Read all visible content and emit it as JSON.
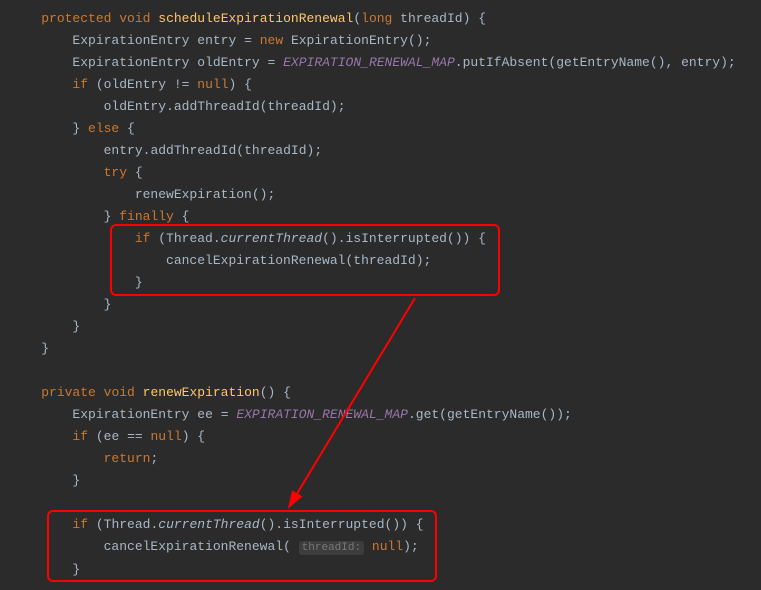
{
  "code": {
    "line1": {
      "kw1": "protected",
      "kw2": "void",
      "method": "scheduleExpirationRenewal",
      "kw3": "long",
      "param": "threadId"
    },
    "line2": {
      "type1": "ExpirationEntry",
      "var": "entry",
      "op": "=",
      "kw": "new",
      "type2": "ExpirationEntry"
    },
    "line3": {
      "type1": "ExpirationEntry",
      "var": "oldEntry",
      "op": "=",
      "field": "EXPIRATION_RENEWAL_MAP",
      "call1": "putIfAbsent",
      "call2": "getEntryName",
      "arg": "entry"
    },
    "line4": {
      "kw": "if",
      "var": "oldEntry",
      "op": "!=",
      "kw2": "null"
    },
    "line5": {
      "var": "oldEntry",
      "call": "addThreadId",
      "arg": "threadId"
    },
    "line6": {
      "kw1": "else"
    },
    "line7": {
      "var": "entry",
      "call": "addThreadId",
      "arg": "threadId"
    },
    "line8": {
      "kw": "try"
    },
    "line9": {
      "call": "renewExpiration"
    },
    "line10": {
      "kw": "finally"
    },
    "line11": {
      "kw": "if",
      "type": "Thread",
      "call1": "currentThread",
      "call2": "isInterrupted"
    },
    "line12": {
      "call": "cancelExpirationRenewal",
      "arg": "threadId"
    },
    "line13": {
      "kw1": "private",
      "kw2": "void",
      "method": "renewExpiration"
    },
    "line14": {
      "type": "ExpirationEntry",
      "var": "ee",
      "op": "=",
      "field": "EXPIRATION_RENEWAL_MAP",
      "call1": "get",
      "call2": "getEntryName"
    },
    "line15": {
      "kw": "if",
      "var": "ee",
      "op": "==",
      "kw2": "null"
    },
    "line16": {
      "kw": "return"
    },
    "line17": {
      "kw": "if",
      "type": "Thread",
      "call1": "currentThread",
      "call2": "isInterrupted"
    },
    "line18": {
      "call": "cancelExpirationRenewal",
      "hint": "threadId:",
      "kw": "null"
    }
  },
  "annotations": {
    "box1_desc": "finally-block-interrupt-check",
    "box2_desc": "renew-expiration-interrupt-check",
    "arrow_desc": "code-relation-arrow"
  }
}
